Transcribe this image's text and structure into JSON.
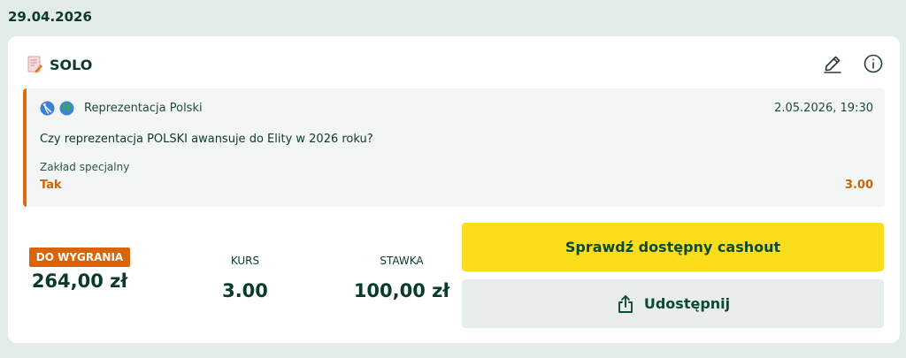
{
  "date_header": "29.04.2026",
  "coupon": {
    "bet_type": "SOLO",
    "icons": {
      "edit": "pencil-icon",
      "info": "info-icon",
      "coupon": "coupon-icon"
    },
    "selection": {
      "sport_icons": [
        "volleyball-icon",
        "globe-icon"
      ],
      "team": "Reprezentacja Polski",
      "datetime": "2.05.2026, 19:30",
      "question": "Czy reprezentacja POLSKI awansuje do Elity w 2026 roku?",
      "market": "Zakład specjalny",
      "pick": "Tak",
      "odds": "3.00"
    },
    "summary": {
      "win_label": "DO WYGRANIA",
      "win_value": "264,00 zł",
      "odds_label": "KURS",
      "odds_value": "3.00",
      "stake_label": "STAWKA",
      "stake_value": "100,00 zł"
    },
    "buttons": {
      "cashout": "Sprawdź dostępny cashout",
      "share": "Udostępnij"
    }
  },
  "colors": {
    "accent_orange": "#d9650b",
    "cashout_yellow": "#fcdd1c",
    "text_dark_green": "#0b3a2a",
    "page_bg": "#e3ebe7"
  }
}
